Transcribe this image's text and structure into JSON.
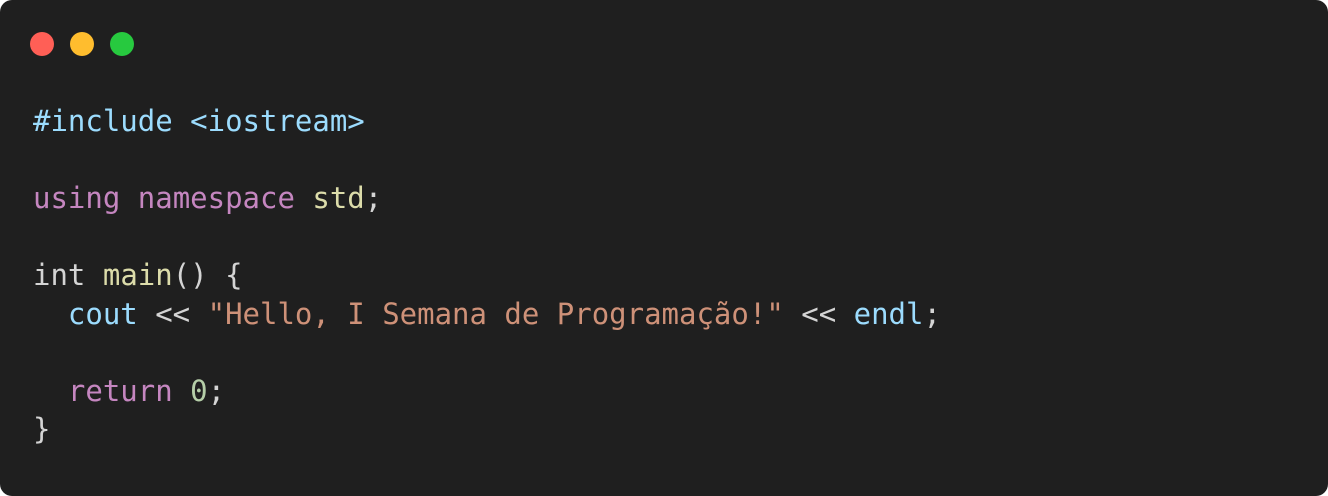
{
  "window": {
    "background": "#1f1f1f",
    "controls": [
      {
        "name": "close",
        "color": "#ff5f56"
      },
      {
        "name": "minimize",
        "color": "#ffbd2e"
      },
      {
        "name": "zoom",
        "color": "#27c93f"
      }
    ]
  },
  "colors": {
    "directive": "#9cdcfe",
    "keyword": "#c586c0",
    "type": "#d4d4d4",
    "function": "#dcdcaa",
    "identifier": "#9cdcfe",
    "string": "#ce9178",
    "number": "#b5cea8",
    "plain": "#d4d4d4"
  },
  "code": {
    "lines": [
      [
        {
          "text": "#include",
          "kind": "directive"
        },
        {
          "text": " ",
          "kind": "plain"
        },
        {
          "text": "<iostream>",
          "kind": "directive"
        }
      ],
      [],
      [
        {
          "text": "using",
          "kind": "keyword"
        },
        {
          "text": " ",
          "kind": "plain"
        },
        {
          "text": "namespace",
          "kind": "keyword"
        },
        {
          "text": " ",
          "kind": "plain"
        },
        {
          "text": "std",
          "kind": "function"
        },
        {
          "text": ";",
          "kind": "plain"
        }
      ],
      [],
      [
        {
          "text": "int",
          "kind": "type"
        },
        {
          "text": " ",
          "kind": "plain"
        },
        {
          "text": "main",
          "kind": "function"
        },
        {
          "text": "() {",
          "kind": "plain"
        }
      ],
      [
        {
          "text": "  ",
          "kind": "plain"
        },
        {
          "text": "cout",
          "kind": "identifier"
        },
        {
          "text": " << ",
          "kind": "plain"
        },
        {
          "text": "\"Hello, I Semana de Programação!\"",
          "kind": "string"
        },
        {
          "text": " << ",
          "kind": "plain"
        },
        {
          "text": "endl",
          "kind": "identifier"
        },
        {
          "text": ";",
          "kind": "plain"
        }
      ],
      [],
      [
        {
          "text": "  ",
          "kind": "plain"
        },
        {
          "text": "return",
          "kind": "keyword"
        },
        {
          "text": " ",
          "kind": "plain"
        },
        {
          "text": "0",
          "kind": "number"
        },
        {
          "text": ";",
          "kind": "plain"
        }
      ],
      [
        {
          "text": "}",
          "kind": "plain"
        }
      ]
    ]
  }
}
